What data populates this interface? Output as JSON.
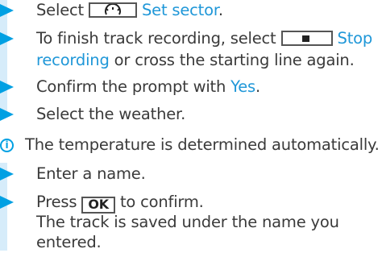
{
  "steps": {
    "set_sector": {
      "before": "Select",
      "link": "Set sector",
      "after": "."
    },
    "finish": {
      "line1_before": "To finish track recording, select",
      "line1_link": "Stop",
      "line2_link": "recording",
      "line2_after": " or cross the starting line again."
    },
    "confirm": {
      "before": "Confirm the prompt with ",
      "link": "Yes",
      "after": "."
    },
    "weather": {
      "text": "Select the weather."
    },
    "info": {
      "text": "The temperature is determined automatically."
    },
    "name": {
      "text": "Enter a name."
    },
    "press": {
      "before": "Press",
      "key": "OK",
      "after": "to confirm.",
      "result_line1": "The track is saved under the name you",
      "result_line2": "entered."
    }
  },
  "icons": {
    "bullet": "triangle-bullet-icon",
    "info": "info-icon",
    "sector": "sector-gauge-icon",
    "stop": "stop-square-icon"
  },
  "colors": {
    "accent": "#00a0e3",
    "link": "#1f97d8",
    "bar": "#d6ecfa",
    "text": "#3a3a3a"
  }
}
